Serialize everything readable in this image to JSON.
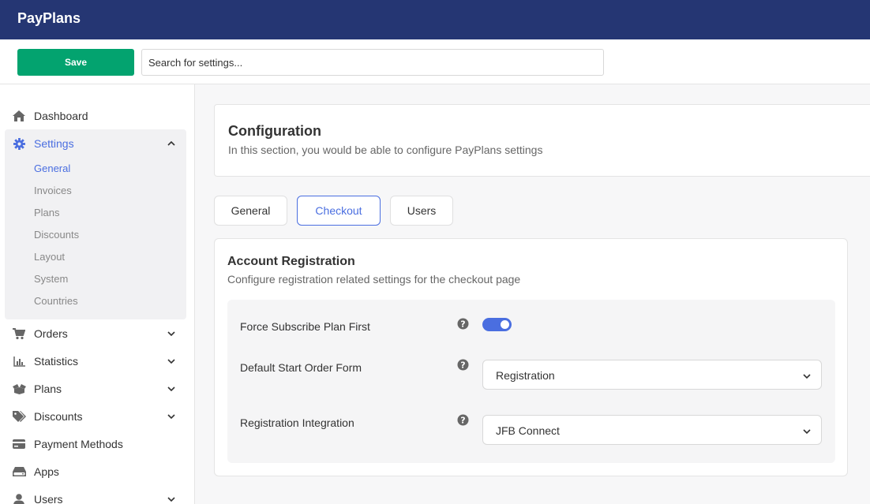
{
  "app": {
    "title": "PayPlans"
  },
  "toolbar": {
    "save_label": "Save",
    "search_placeholder": "Search for settings..."
  },
  "sidebar": {
    "items": [
      {
        "label": "Dashboard",
        "icon": "home-icon"
      },
      {
        "label": "Settings",
        "icon": "gear-icon",
        "expanded": true
      },
      {
        "label": "Orders",
        "icon": "cart-icon"
      },
      {
        "label": "Statistics",
        "icon": "bar-chart-icon"
      },
      {
        "label": "Plans",
        "icon": "boxes-icon"
      },
      {
        "label": "Discounts",
        "icon": "tags-icon"
      },
      {
        "label": "Payment Methods",
        "icon": "credit-card-icon"
      },
      {
        "label": "Apps",
        "icon": "hdd-icon"
      },
      {
        "label": "Users",
        "icon": "user-icon"
      }
    ],
    "settings_sub": [
      "General",
      "Invoices",
      "Plans",
      "Discounts",
      "Layout",
      "System",
      "Countries"
    ],
    "active_sub": "General"
  },
  "main": {
    "title": "Configuration",
    "description": "In this section, you would be able to configure PayPlans settings",
    "tabs": [
      {
        "label": "General"
      },
      {
        "label": "Checkout",
        "active": true
      },
      {
        "label": "Users"
      }
    ],
    "section": {
      "title": "Account Registration",
      "description": "Configure registration related settings for the checkout page",
      "fields": [
        {
          "label": "Force Subscribe Plan First",
          "type": "toggle",
          "on": true
        },
        {
          "label": "Default Start Order Form",
          "type": "select",
          "value": "Registration"
        },
        {
          "label": "Registration Integration",
          "type": "select",
          "value": "JFB Connect"
        }
      ]
    }
  },
  "colors": {
    "topbar": "#253673",
    "save": "#03a36f",
    "accent": "#4a6ee0"
  }
}
